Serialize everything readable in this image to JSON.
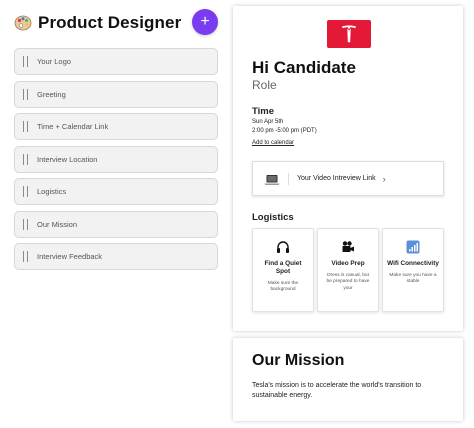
{
  "header": {
    "title": "Product Designer",
    "palette_icon": "palette-icon",
    "add_label": "+"
  },
  "sections": [
    {
      "label": "Your Logo"
    },
    {
      "label": "Greeting"
    },
    {
      "label": "Time + Calendar Link"
    },
    {
      "label": "Interview Location"
    },
    {
      "label": "Logistics"
    },
    {
      "label": "Our Mission"
    },
    {
      "label": "Interview Feedback"
    }
  ],
  "preview": {
    "logo_icon": "tesla-logo",
    "brand_color": "#e31937",
    "greeting": "Hi Candidate",
    "role": "Role",
    "time": {
      "title": "Time",
      "date": "Sun Apr 5th",
      "range": "2:00 pm -5:00 pm (PDT)",
      "add_to_calendar": "Add to calendar"
    },
    "video": {
      "icon": "laptop-icon",
      "label": "Your Video Intreview Link",
      "chevron": "›"
    },
    "logistics": {
      "title": "Logistics",
      "items": [
        {
          "icon": "headphones-icon",
          "title": "Find a Quiet Spot",
          "desc": "Make sure the background"
        },
        {
          "icon": "camera-icon",
          "title": "Video Prep",
          "desc": "Dress is casual, but be prepared to have your"
        },
        {
          "icon": "signal-icon",
          "title": "Wifi Connectivity",
          "desc": "Make sure you have a stable"
        }
      ]
    },
    "mission": {
      "title": "Our Mission",
      "text": "Tesla's mission is to accelerate the world's transition to sustainable energy."
    }
  },
  "colors": {
    "accent": "#7a3cf0",
    "section_bg": "#f2f2f2"
  }
}
